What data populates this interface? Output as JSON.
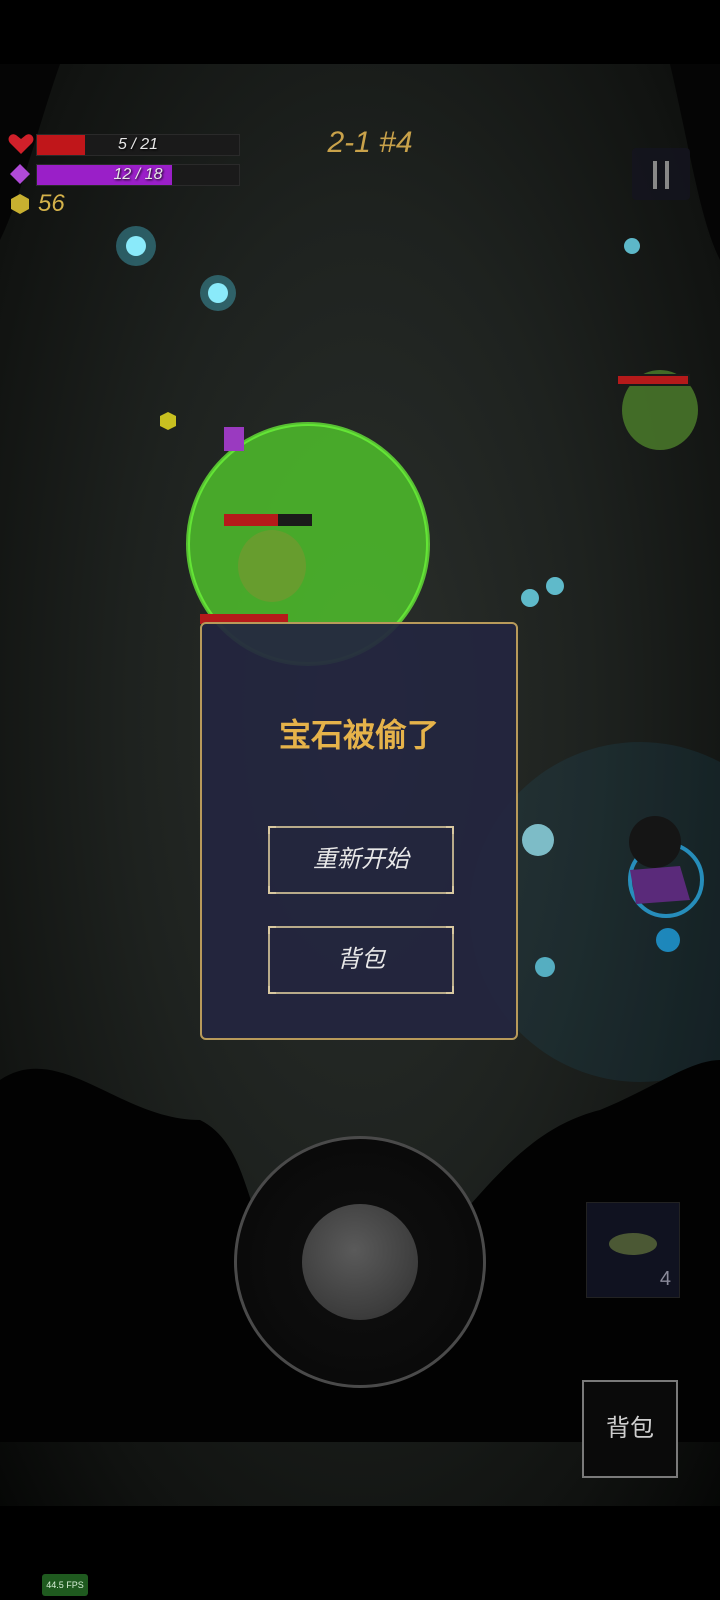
{
  "hud": {
    "hp_text": "5 / 21",
    "hp_fraction": 0.238,
    "mp_text": "12 / 18",
    "mp_fraction": 0.667,
    "gold": "56",
    "level": "2-1 #4",
    "hp_color": "#c0161a",
    "mp_color": "#9a1fc8",
    "gold_color": "#d4b24a"
  },
  "dialog": {
    "title": "宝石被偷了",
    "restart_label": "重新开始",
    "bag_label": "背包"
  },
  "controls": {
    "bag_label": "背包",
    "skill_count": "4",
    "fps": "44.5 FPS"
  },
  "icons": {
    "heart": "heart-icon",
    "mana": "diamond-icon",
    "gold": "hexagon-gem-icon",
    "pause": "pause-icon",
    "skill": "leaf-icon"
  }
}
